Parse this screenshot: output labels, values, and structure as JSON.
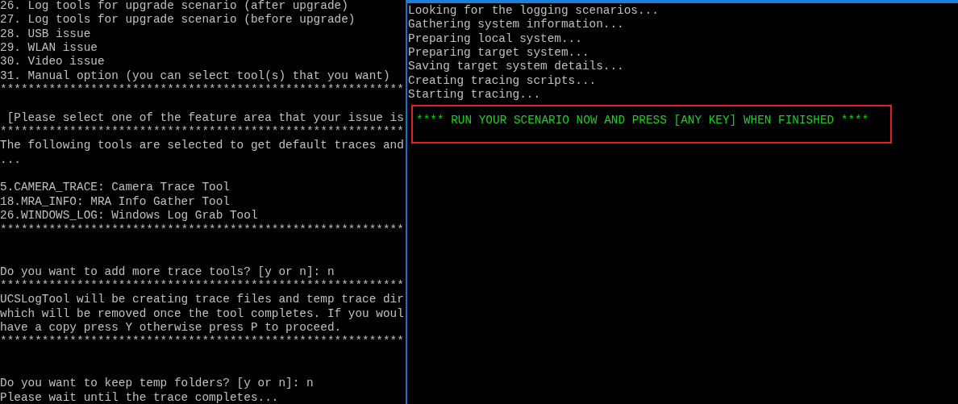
{
  "left_console": {
    "lines": [
      {
        "kind": "text",
        "text": "26. Log tools for upgrade scenario (after upgrade)"
      },
      {
        "kind": "text",
        "text": "27. Log tools for upgrade scenario (before upgrade)"
      },
      {
        "kind": "text",
        "text": "28. USB issue"
      },
      {
        "kind": "text",
        "text": "29. WLAN issue"
      },
      {
        "kind": "text",
        "text": "30. Video issue"
      },
      {
        "kind": "text",
        "text": "31. Manual option (you can select tool(s) that you want)"
      },
      {
        "kind": "text",
        "text": "**********************************************************"
      },
      {
        "kind": "blank"
      },
      {
        "kind": "text",
        "text": " [Please select one of the feature area that your issue is"
      },
      {
        "kind": "text",
        "text": "**********************************************************"
      },
      {
        "kind": "text",
        "text": "The following tools are selected to get default traces and"
      },
      {
        "kind": "text",
        "text": "..."
      },
      {
        "kind": "blank"
      },
      {
        "kind": "text",
        "text": "5.CAMERA_TRACE: Camera Trace Tool"
      },
      {
        "kind": "text",
        "text": "18.MRA_INFO: MRA Info Gather Tool"
      },
      {
        "kind": "text",
        "text": "26.WINDOWS_LOG: Windows Log Grab Tool"
      },
      {
        "kind": "text",
        "text": "**********************************************************"
      },
      {
        "kind": "blank"
      },
      {
        "kind": "blank"
      },
      {
        "kind": "text",
        "text": "Do you want to add more trace tools? [y or n]: n"
      },
      {
        "kind": "text",
        "text": "**********************************************************"
      },
      {
        "kind": "text",
        "text": "UCSLogTool will be creating trace files and temp trace dir"
      },
      {
        "kind": "text",
        "text": "which will be removed once the tool completes. If you woul"
      },
      {
        "kind": "text",
        "text": "have a copy press Y otherwise press P to proceed."
      },
      {
        "kind": "text",
        "text": "**********************************************************"
      },
      {
        "kind": "blank"
      },
      {
        "kind": "blank"
      },
      {
        "kind": "text",
        "text": "Do you want to keep temp folders? [y or n]: n"
      },
      {
        "kind": "text",
        "text": "Please wait until the trace completes..."
      }
    ]
  },
  "right_console": {
    "lines": [
      {
        "kind": "text",
        "text": "Looking for the logging scenarios..."
      },
      {
        "kind": "text",
        "text": "Gathering system information..."
      },
      {
        "kind": "text",
        "text": "Preparing local system..."
      },
      {
        "kind": "text",
        "text": "Preparing target system..."
      },
      {
        "kind": "text",
        "text": "Saving target system details..."
      },
      {
        "kind": "text",
        "text": "Creating tracing scripts..."
      },
      {
        "kind": "text",
        "text": "Starting tracing..."
      },
      {
        "kind": "highlight",
        "text": "**** RUN YOUR SCENARIO NOW AND PRESS [ANY KEY] WHEN FINISHED ****"
      }
    ]
  }
}
